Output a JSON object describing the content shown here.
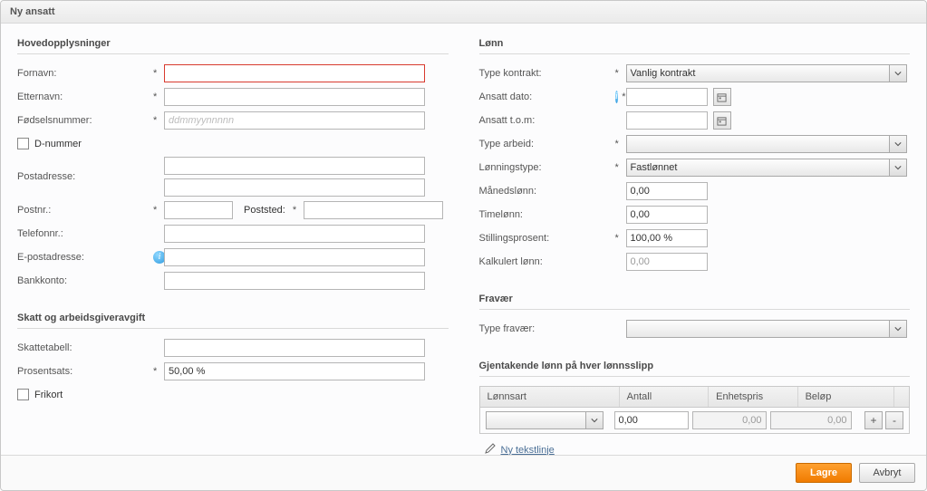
{
  "window_title": "Ny ansatt",
  "left": {
    "sections": {
      "main": {
        "title": "Hovedopplysninger",
        "fornavn": "Fornavn:",
        "etternavn": "Etternavn:",
        "fodselsnr": "Fødselsnummer:",
        "fodselsnr_ph": "ddmmyynnnnn",
        "dnummer": "D-nummer",
        "postadresse": "Postadresse:",
        "postnr": "Postnr.:",
        "poststed": "Poststed:",
        "telefonnr": "Telefonnr.:",
        "epost": "E-postadresse:",
        "bankkonto": "Bankkonto:"
      },
      "tax": {
        "title": "Skatt og arbeidsgiveravgift",
        "skattetabell": "Skattetabell:",
        "prosentsats": "Prosentsats:",
        "prosentsats_val": "50,00 %",
        "frikort": "Frikort"
      }
    }
  },
  "right": {
    "salary": {
      "title": "Lønn",
      "type_kontrakt": "Type kontrakt:",
      "type_kontrakt_val": "Vanlig kontrakt",
      "ansatt_dato": "Ansatt dato:",
      "ansatt_tom": "Ansatt t.o.m:",
      "type_arbeid": "Type arbeid:",
      "lonningstype": "Lønningstype:",
      "lonningstype_val": "Fastlønnet",
      "manedslonn": "Månedslønn:",
      "manedslonn_val": "0,00",
      "timelonn": "Timelønn:",
      "timelonn_val": "0,00",
      "stillingsprosent": "Stillingsprosent:",
      "stillingsprosent_val": "100,00 %",
      "kalkulert": "Kalkulert lønn:",
      "kalkulert_val": "0,00"
    },
    "absence": {
      "title": "Fravær",
      "type_fravaer": "Type fravær:"
    },
    "recurring": {
      "title": "Gjentakende lønn på hver lønnsslipp",
      "cols": {
        "lonnsart": "Lønnsart",
        "antall": "Antall",
        "enhetspris": "Enhetspris",
        "belop": "Beløp"
      },
      "row": {
        "antall": "0,00",
        "enhetspris": "0,00",
        "belop": "0,00"
      },
      "newline": "Ny tekstlinje"
    }
  },
  "footer": {
    "save": "Lagre",
    "cancel": "Avbryt"
  },
  "asterisk": "*"
}
